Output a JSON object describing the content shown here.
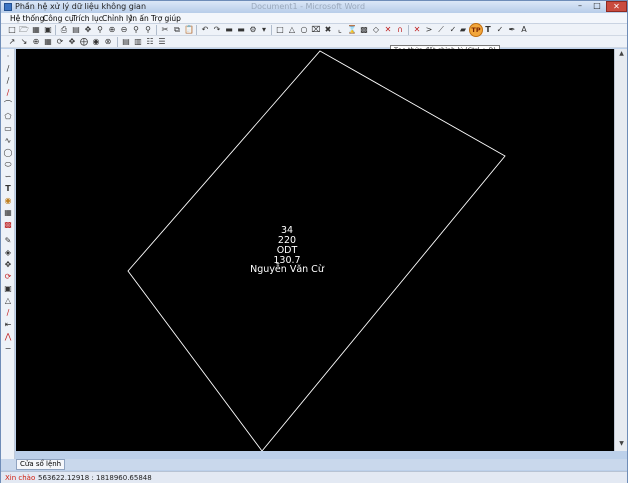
{
  "window": {
    "title": "Phần hệ xử lý dữ liệu không gian",
    "background_title": "Document1 - Microsoft Word"
  },
  "menu": [
    "Hệ thống",
    "Công cụ",
    "Trích lục",
    "Chỉnh lý",
    "In ấn",
    "Trợ giúp"
  ],
  "toolbar": {
    "active_tool": "TP",
    "tooltip": "Tạo thửa đất chỉnh lý  (Ctrl + B)"
  },
  "parcel": {
    "number": "34",
    "area_code": "220",
    "land_use": "ODT",
    "area": "130.7",
    "owner": "Nguyễn Văn Cừ"
  },
  "command_tab": "Cửa sổ lệnh",
  "status": {
    "greeting": "Xin chào",
    "coordinates": "563622.12918 : 1818960.65848"
  },
  "colors": {
    "canvas": "#000000",
    "parcel_outline": "#ffffff",
    "status_greeting": "#d02010",
    "active_tool": "#f2a63b"
  }
}
